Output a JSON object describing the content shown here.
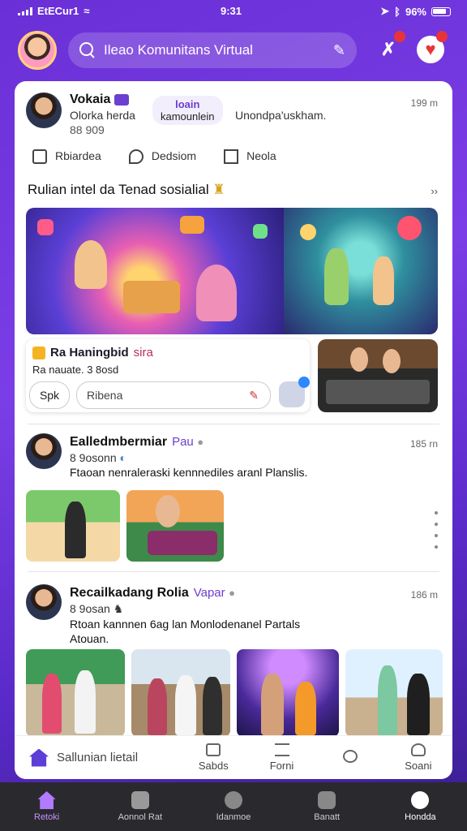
{
  "status": {
    "carrier": "ЕtECur1",
    "time": "9:31",
    "battery": "96%"
  },
  "search": {
    "placeholder": "Ileao Komunitans Virtual"
  },
  "posts": [
    {
      "name": "Vokaia",
      "tag": "",
      "meta": "Olorka herda",
      "stats": "88 909",
      "time": "199 m",
      "chip_title": "loain",
      "chip_text": "kamounlein",
      "comment": "Unondpa'uskham.",
      "actions": [
        "Rbiardea",
        "Dedsiom",
        "Neola"
      ],
      "section_title": "Rulian intel da Tenad sosialial",
      "section_more": "››",
      "game_title": "Ra Haningbid",
      "game_accent": "sira",
      "game_sub": "Ra nauate.  3 8osd",
      "game_button": "Spk",
      "game_input": "Ribena"
    },
    {
      "name": "Ealledmbermiar",
      "tag": "Pau",
      "meta": "8 9osonn",
      "time": "185 rn",
      "text": "Ftaoan nenraleraski kennnediles aranl Planslis."
    },
    {
      "name": "Recailkadang Rolia",
      "tag": "Vapar",
      "meta": "8 9osan",
      "time": "186 m",
      "text": "Rtoan kannnen 6ag lan Monlodenanel Partals Atouan."
    }
  ],
  "composer": {
    "main": "Sallunian lietail",
    "items": [
      "Sabds",
      "Forni",
      "",
      "Soani"
    ]
  },
  "nav": [
    "Retoki",
    "Aonnol Rat",
    "Idanmoe",
    "Banatt",
    "Hondda"
  ],
  "colors": {
    "accent": "#6b3fd0",
    "badge": "#e8333b"
  }
}
